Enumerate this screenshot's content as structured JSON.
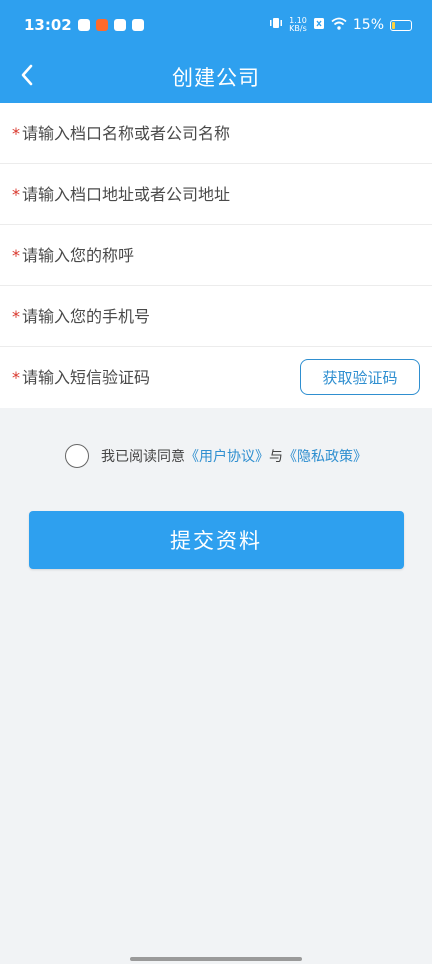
{
  "status_bar": {
    "time": "13:02",
    "net_speed_value": "1.10",
    "net_speed_unit": "KB/s",
    "battery": "15%"
  },
  "header": {
    "title": "创建公司"
  },
  "form": {
    "stall_name_placeholder": "请输入档口名称或者公司名称",
    "stall_address_placeholder": "请输入档口地址或者公司地址",
    "name_placeholder": "请输入您的称呼",
    "phone_placeholder": "请输入您的手机号",
    "sms_code_placeholder": "请输入短信验证码",
    "get_code_label": "获取验证码",
    "required_mark": "*"
  },
  "agreement": {
    "prefix": "我已阅读同意",
    "user_agreement": "《用户协议》",
    "joiner": "与",
    "privacy_policy": "《隐私政策》"
  },
  "submit_label": "提交资料",
  "colors": {
    "primary": "#2ea0ef",
    "link": "#2f8fd0",
    "required": "#d9362b",
    "background": "#f1f3f5"
  }
}
